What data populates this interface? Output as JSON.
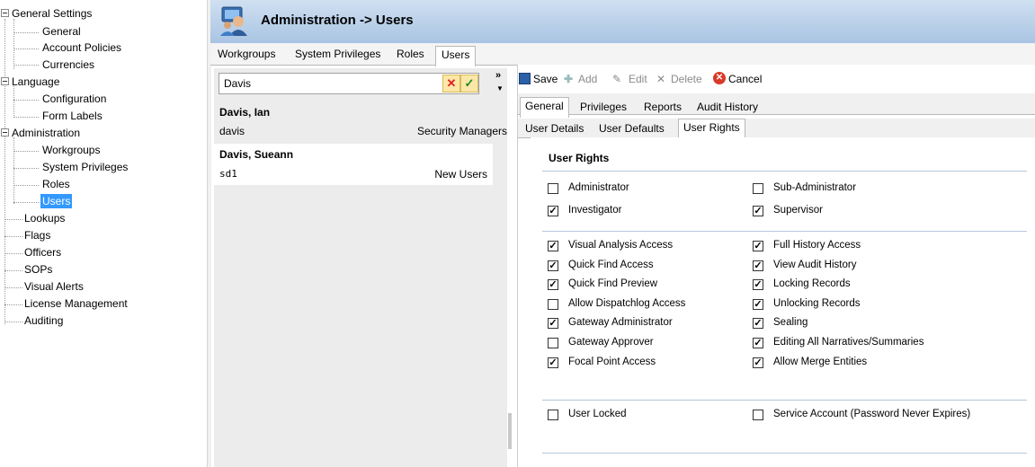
{
  "tree": {
    "general_settings": "General Settings",
    "general": "General",
    "account_policies": "Account Policies",
    "currencies": "Currencies",
    "language": "Language",
    "configuration": "Configuration",
    "form_labels": "Form Labels",
    "administration": "Administration",
    "workgroups": "Workgroups",
    "system_privileges": "System Privileges",
    "roles": "Roles",
    "users": "Users",
    "lookups": "Lookups",
    "flags": "Flags",
    "officers": "Officers",
    "sops": "SOPs",
    "visual_alerts": "Visual Alerts",
    "license_management": "License Management",
    "auditing": "Auditing"
  },
  "header": {
    "title": "Administration  ->  Users"
  },
  "top_tabs": [
    "Workgroups",
    "System Privileges",
    "Roles",
    "Users"
  ],
  "search": {
    "value": "Davis"
  },
  "user_list": [
    {
      "name": "Davis, Ian",
      "login": "davis",
      "group": "Security Managers"
    },
    {
      "name": "Davis, Sueann",
      "login": "sd1",
      "group": "New Users"
    }
  ],
  "toolbar": {
    "save": "Save",
    "add": "Add",
    "edit": "Edit",
    "delete": "Delete",
    "cancel": "Cancel"
  },
  "detail_tabs": [
    "General",
    "Privileges",
    "Reports",
    "Audit History"
  ],
  "sub_tabs": [
    "User Details",
    "User Defaults",
    "User Rights"
  ],
  "rights": {
    "heading": "User Rights",
    "group1": [
      {
        "label": "Administrator",
        "checked": false
      },
      {
        "label": "Sub-Administrator",
        "checked": false
      },
      {
        "label": "Investigator",
        "checked": true
      },
      {
        "label": "Supervisor",
        "checked": true
      }
    ],
    "group2_left": [
      {
        "label": "Visual Analysis Access",
        "checked": true
      },
      {
        "label": "Quick Find Access",
        "checked": true
      },
      {
        "label": "Quick Find Preview",
        "checked": true
      },
      {
        "label": "Allow Dispatchlog Access",
        "checked": false
      },
      {
        "label": "Gateway Administrator",
        "checked": true
      },
      {
        "label": "Gateway Approver",
        "checked": false
      },
      {
        "label": "Focal Point Access",
        "checked": true
      }
    ],
    "group2_right": [
      {
        "label": "Full History Access",
        "checked": true
      },
      {
        "label": "View Audit History",
        "checked": true
      },
      {
        "label": "Locking Records",
        "checked": true
      },
      {
        "label": "Unlocking Records",
        "checked": true
      },
      {
        "label": "Sealing",
        "checked": true
      },
      {
        "label": "Editing All Narratives/Summaries",
        "checked": true
      },
      {
        "label": "Allow Merge Entities",
        "checked": true
      }
    ],
    "user_locked": {
      "label": "User Locked",
      "checked": false
    },
    "service_account": {
      "label": "Service Account (Password Never Expires)",
      "checked": false
    }
  },
  "colors": {
    "selected": "#3399ff",
    "header_top": "#cfe0f1",
    "header_bottom": "#a9c4e3"
  }
}
